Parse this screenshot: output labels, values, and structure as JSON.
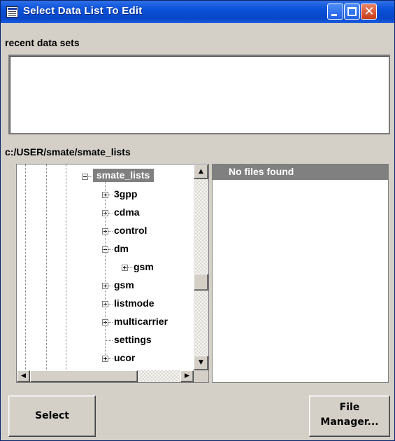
{
  "window": {
    "title": "Select Data List To Edit",
    "buttons": {
      "minimize": "",
      "maximize": "",
      "close": "✕"
    }
  },
  "recent": {
    "label": "recent data sets"
  },
  "path": "c:/USER/smate/smate_lists",
  "tree": {
    "root": "smate_lists",
    "items": [
      {
        "label": "3gpp",
        "icon": "plus-box"
      },
      {
        "label": "cdma",
        "icon": "plus-box"
      },
      {
        "label": "control",
        "icon": "plus-box"
      },
      {
        "label": "dm",
        "icon": "minus-box"
      },
      {
        "label": "gsm",
        "icon": "plus-box",
        "child_of": "dm"
      },
      {
        "label": "gsm",
        "icon": "plus-box"
      },
      {
        "label": "listmode",
        "icon": "plus-box"
      },
      {
        "label": "multicarrier",
        "icon": "plus-box"
      },
      {
        "label": "settings",
        "icon": "none"
      },
      {
        "label": "ucor",
        "icon": "plus-box"
      }
    ],
    "scroll_up": "▲",
    "scroll_down": "▼",
    "scroll_left": "◀",
    "scroll_right": "▶"
  },
  "files": {
    "header": "No files found"
  },
  "footer": {
    "select_label": "Select",
    "file_manager_label": "File\nManager..."
  }
}
